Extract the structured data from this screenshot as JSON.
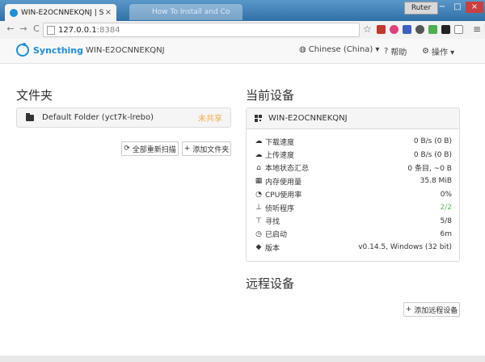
{
  "browser": {
    "tab_title": "WIN-E2OCNNEKQNJ | S",
    "tab_close": "×",
    "second_tab_title": "How To Install and Co",
    "user_badge": "Ruter",
    "url_host": "127.0.0.1",
    "url_port": ":8384",
    "back": "←",
    "forward": "→",
    "reload": "C",
    "star": "☆",
    "menu": "≡",
    "win_min": "−",
    "win_max": "□",
    "win_close": "×",
    "colors": {
      "tabbar": "#3d7fb5",
      "accent": "#1e8ee0"
    }
  },
  "navbar": {
    "brand": "Syncthing",
    "device_name": "WIN-E2OCNNEKQNJ",
    "language": "Chinese (China) ▾",
    "help": "帮助",
    "actions": "操作 ▾"
  },
  "folders": {
    "heading": "文件夹",
    "items": [
      {
        "label": "Default Folder (yct7k-lrebo)",
        "status": "未共享"
      }
    ],
    "rescan_all": "全部重新扫描",
    "add_folder": "添加文件夹"
  },
  "this_device": {
    "heading": "当前设备",
    "name": "WIN-E2OCNNEKQNJ",
    "stats": [
      {
        "icon": "cloud-download-icon",
        "label": "下载速度",
        "value": "0 B/s (0 B)"
      },
      {
        "icon": "cloud-upload-icon",
        "label": "上传速度",
        "value": "0 B/s (0 B)"
      },
      {
        "icon": "home-icon",
        "label": "本地状态汇总",
        "value": "0 条目, ~0 B"
      },
      {
        "icon": "memory-icon",
        "label": "内存使用量",
        "value": "35.8 MiB"
      },
      {
        "icon": "dashboard-icon",
        "label": "CPU使用率",
        "value": "0%"
      },
      {
        "icon": "sitemap-icon",
        "label": "侦听程序",
        "value": "2/2",
        "color": "#5cb85c"
      },
      {
        "icon": "signpost-icon",
        "label": "寻找",
        "value": "5/8"
      },
      {
        "icon": "clock-icon",
        "label": "已启动",
        "value": "6m"
      },
      {
        "icon": "tag-icon",
        "label": "版本",
        "value": "v0.14.5, Windows (32 bit)"
      }
    ]
  },
  "remote_devices": {
    "heading": "远程设备",
    "add_remote": "添加远程设备"
  }
}
